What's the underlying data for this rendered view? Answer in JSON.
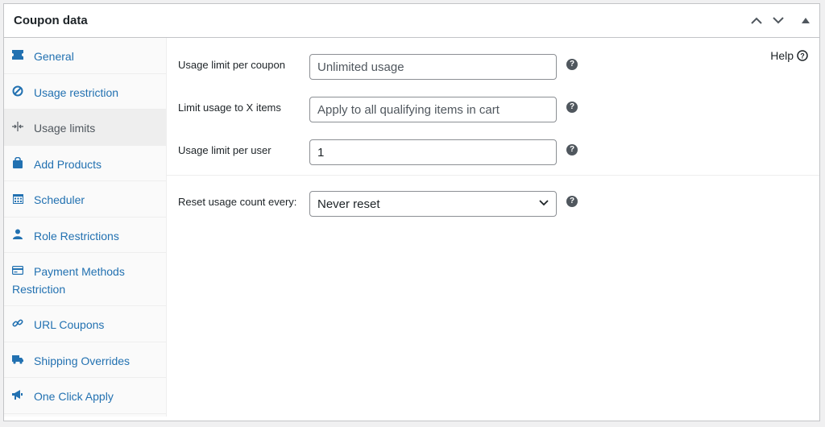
{
  "panel": {
    "title": "Coupon data"
  },
  "sidebar": {
    "items": [
      {
        "label": "General",
        "icon": "ticket-icon"
      },
      {
        "label": "Usage restriction",
        "icon": "block-icon"
      },
      {
        "label": "Usage limits",
        "icon": "arrows-in-icon",
        "active": true
      },
      {
        "label": "Add Products",
        "icon": "shopping-bag-icon"
      },
      {
        "label": "Scheduler",
        "icon": "calendar-icon"
      },
      {
        "label": "Role Restrictions",
        "icon": "user-icon"
      },
      {
        "label": "Payment Methods Restriction",
        "icon": "credit-card-icon"
      },
      {
        "label": "URL Coupons",
        "icon": "link-icon"
      },
      {
        "label": "Shipping Overrides",
        "icon": "truck-icon"
      },
      {
        "label": "One Click Apply",
        "icon": "megaphone-icon"
      }
    ]
  },
  "help": {
    "label": "Help"
  },
  "fields": {
    "usage_limit_per_coupon": {
      "label": "Usage limit per coupon",
      "value": "",
      "placeholder": "Unlimited usage"
    },
    "limit_usage_to_x_items": {
      "label": "Limit usage to X items",
      "value": "",
      "placeholder": "Apply to all qualifying items in cart"
    },
    "usage_limit_per_user": {
      "label": "Usage limit per user",
      "value": "1",
      "placeholder": ""
    },
    "reset_usage_count": {
      "label": "Reset usage count every:",
      "selected": "Never reset"
    }
  },
  "tooltip_glyph": "?",
  "colors": {
    "link": "#2271b1",
    "active_tab_bg": "#eeeeee",
    "border": "#c3c4c7"
  }
}
